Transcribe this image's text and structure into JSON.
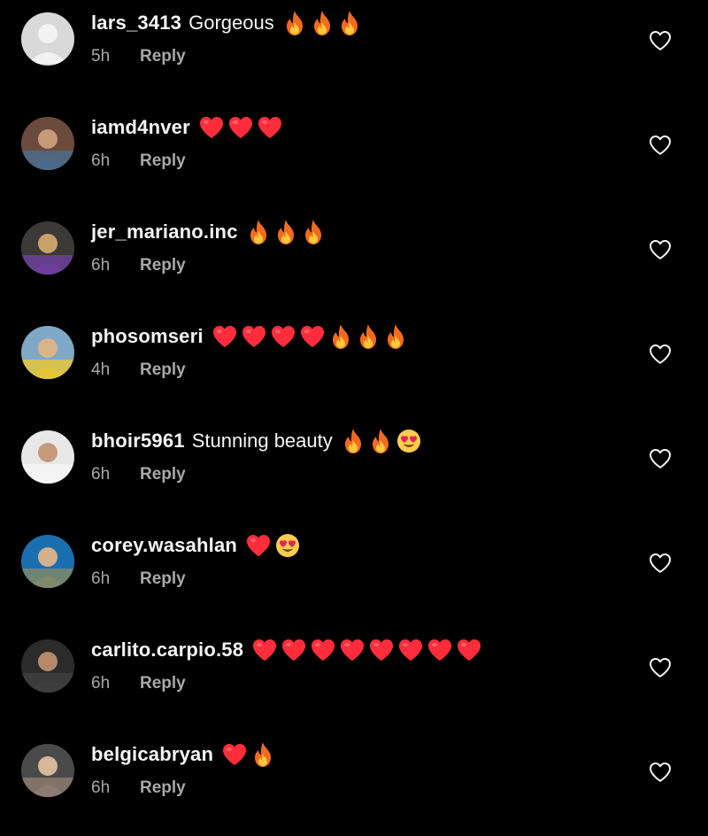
{
  "reply_label": "Reply",
  "colors": {
    "background": "#000000",
    "text": "#f5f5f5",
    "muted": "#a8a8a8",
    "heart": "#ff2d3b"
  },
  "comments": [
    {
      "username": "lars_3413",
      "text": "Gorgeous",
      "time": "5h",
      "emojis": [
        "fire",
        "fire",
        "fire"
      ],
      "avatar": "default-avatar"
    },
    {
      "username": "iamd4nver",
      "text": "",
      "time": "6h",
      "emojis": [
        "red-heart",
        "red-heart",
        "red-heart"
      ],
      "avatar": "photo-avatar"
    },
    {
      "username": "jer_mariano.inc",
      "text": "",
      "time": "6h",
      "emojis": [
        "fire",
        "fire",
        "fire"
      ],
      "avatar": "photo-avatar"
    },
    {
      "username": "phosomseri",
      "text": "",
      "time": "4h",
      "emojis": [
        "red-heart",
        "red-heart",
        "red-heart",
        "red-heart",
        "fire",
        "fire",
        "fire"
      ],
      "avatar": "photo-avatar"
    },
    {
      "username": "bhoir5961",
      "text": "Stunning beauty",
      "time": "6h",
      "emojis": [
        "fire",
        "fire",
        "heart-eyes"
      ],
      "avatar": "photo-avatar"
    },
    {
      "username": "corey.wasahlan",
      "text": "",
      "time": "6h",
      "emojis": [
        "red-heart",
        "heart-eyes"
      ],
      "avatar": "photo-avatar"
    },
    {
      "username": "carlito.carpio.58",
      "text": "",
      "time": "6h",
      "emojis": [
        "red-heart",
        "red-heart",
        "red-heart",
        "red-heart",
        "red-heart",
        "red-heart",
        "red-heart",
        "red-heart"
      ],
      "avatar": "photo-avatar"
    },
    {
      "username": "belgicabryan",
      "text": "",
      "time": "6h",
      "emojis": [
        "red-heart",
        "fire"
      ],
      "avatar": "photo-avatar"
    }
  ]
}
